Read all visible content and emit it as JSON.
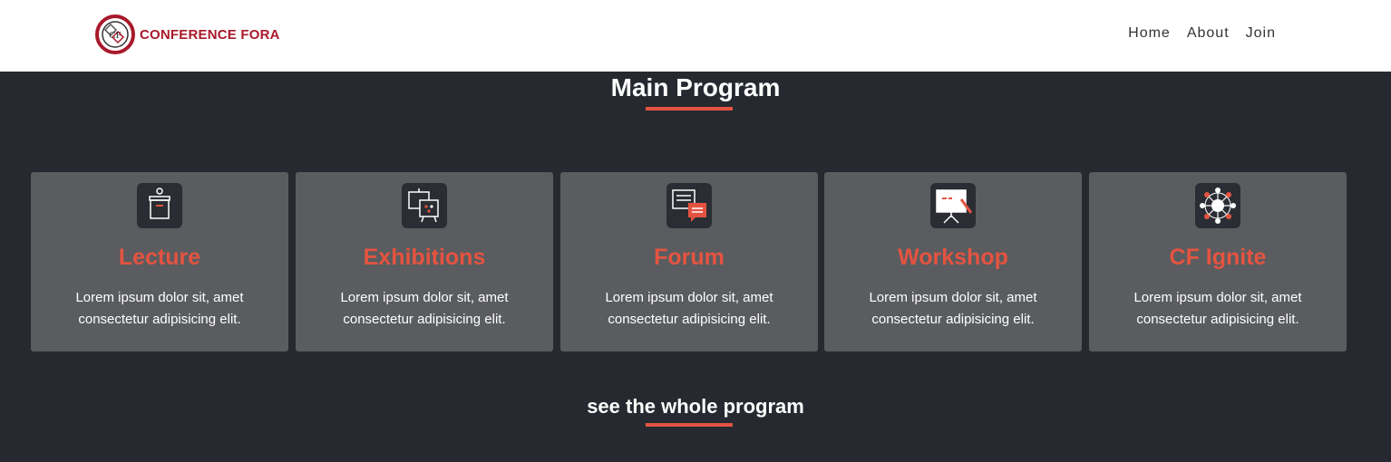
{
  "brand": {
    "name": "CONFERENCE FORA",
    "mark_letters": "CF",
    "accent": "#a8192b"
  },
  "nav": [
    {
      "label": "Home"
    },
    {
      "label": "About"
    },
    {
      "label": "Join"
    }
  ],
  "main": {
    "title": "Main Program",
    "accent": "#e45341",
    "cards": [
      {
        "title": "Lecture",
        "icon": "lectern-icon",
        "text": "Lorem ipsum dolor sit, amet consectetur adipisicing elit."
      },
      {
        "title": "Exhibitions",
        "icon": "easel-exhibition-icon",
        "text": "Lorem ipsum dolor sit, amet consectetur adipisicing elit."
      },
      {
        "title": "Forum",
        "icon": "chat-bubbles-icon",
        "text": "Lorem ipsum dolor sit, amet consectetur adipisicing elit."
      },
      {
        "title": "Workshop",
        "icon": "whiteboard-icon",
        "text": "Lorem ipsum dolor sit, amet consectetur adipisicing elit."
      },
      {
        "title": "CF Ignite",
        "icon": "network-hub-icon",
        "text": "Lorem ipsum dolor sit, amet consectetur adipisicing elit."
      }
    ],
    "cta": "see the whole program"
  }
}
